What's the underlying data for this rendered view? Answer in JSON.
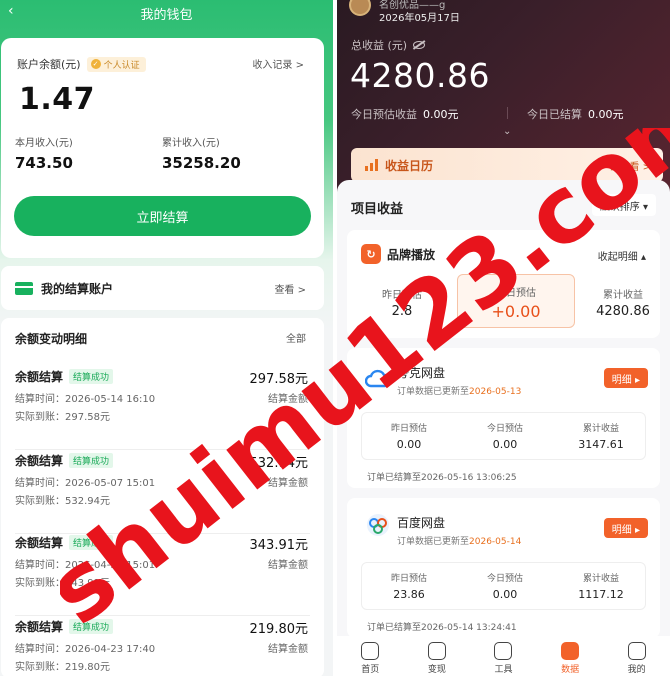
{
  "wallet": {
    "back_icon": "chevron-left-icon",
    "title": "我的钱包",
    "balance_label": "账户余额(元)",
    "verified_badge": "个人认证",
    "income_record_link": "收入记录 >",
    "balance": "1.47",
    "month_income_label": "本月收入(元)",
    "month_income": "743.50",
    "total_income_label": "累计收入(元)",
    "total_income": "35258.20",
    "settle_button": "立即结算",
    "settle_account_title": "我的结算账户",
    "settle_account_view": "查看 >",
    "changes_title": "余额变动明细",
    "changes_all": "全部",
    "records": [
      {
        "name": "余额结算",
        "status": "结算成功",
        "time": "结算时间：2026-05-14 16:10",
        "paid": "实际到账：297.58元",
        "amount": "297.58元",
        "amount_label": "结算金额"
      },
      {
        "name": "余额结算",
        "status": "结算成功",
        "time": "结算时间：2026-05-07 15:01",
        "paid": "实际到账：532.94元",
        "amount": "532.94元",
        "amount_label": "结算金额"
      },
      {
        "name": "余额结算",
        "status": "结算成功",
        "time": "结算时间：2026-04-30 15:01",
        "paid": "实际到账：343.91元",
        "amount": "343.91元",
        "amount_label": "结算金额"
      },
      {
        "name": "余额结算",
        "status": "结算成功",
        "time": "结算时间：2026-04-23 17:40",
        "paid": "实际到账：219.80元",
        "amount": "219.80元",
        "amount_label": "结算金额"
      }
    ]
  },
  "earnings": {
    "user_name": "名创优品——g",
    "date": "2026年05月17日",
    "total_label": "总收益 (元)",
    "total": "4280.86",
    "today_est_label": "今日预估收益",
    "today_est": "0.00元",
    "today_settled_label": "今日已结算",
    "today_settled": "0.00元",
    "calendar_label": "收益日历",
    "calendar_link": "去看看 >",
    "project_title": "项目收益",
    "sort_label": "默认排序 ▾",
    "brand": {
      "name": "品牌播放",
      "toggle": "收起明细 ▴",
      "yesterday_label": "昨日预估",
      "yesterday": "2.8",
      "today_label": "今日预估",
      "today": "+0.00",
      "total_label": "累计收益",
      "total": "4280.86"
    },
    "platforms": [
      {
        "name": "夸克网盘",
        "updated_prefix": "订单数据已更新至",
        "updated_date": "2026-05-13",
        "detail": "明细 ▸",
        "yesterday_label": "昨日预估",
        "yesterday": "0.00",
        "today_label": "今日预估",
        "today": "0.00",
        "total_label": "累计收益",
        "total": "3147.61",
        "settled": "订单已结算至2026-05-16 13:06:25"
      },
      {
        "name": "百度网盘",
        "updated_prefix": "订单数据已更新至",
        "updated_date": "2026-05-14",
        "detail": "明细 ▸",
        "yesterday_label": "昨日预估",
        "yesterday": "23.86",
        "today_label": "今日预估",
        "today": "0.00",
        "total_label": "累计收益",
        "total": "1117.12",
        "settled": "订单已结算至2026-05-14 13:24:41"
      }
    ],
    "tabs": [
      "首页",
      "变现",
      "工具",
      "数据",
      "我的"
    ]
  },
  "watermark": "shuimu123.com",
  "colors": {
    "green": "#18b15e",
    "orange": "#f2622a",
    "watermark_red": "#e8141c"
  }
}
